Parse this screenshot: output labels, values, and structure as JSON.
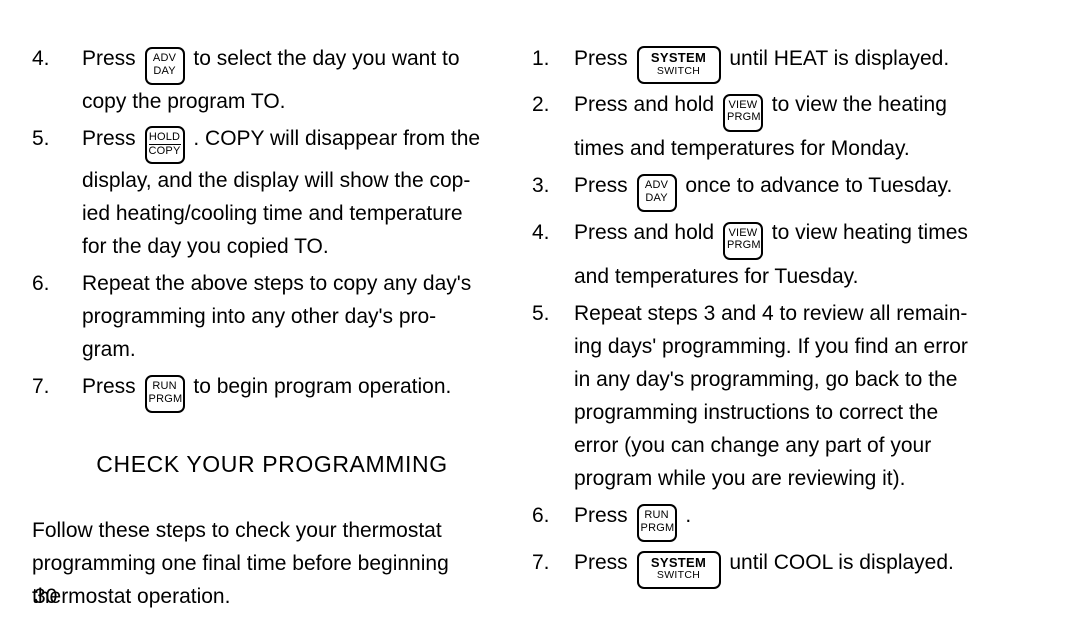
{
  "page": {
    "number": "30",
    "background": "#ffffff",
    "text_color": "#000000"
  },
  "keys": {
    "adv_day": {
      "line1": "ADV",
      "line2": "DAY",
      "ruled": false,
      "wide": false
    },
    "hold_copy": {
      "line1": "HOLD",
      "line2": "COPY",
      "ruled": true,
      "wide": false
    },
    "run_prgm": {
      "line1": "RUN",
      "line2": "PRGM",
      "ruled": false,
      "wide": false
    },
    "view_prgm": {
      "line1": "VIEW",
      "line2": "PRGM",
      "ruled": false,
      "wide": false
    },
    "system_switch": {
      "line1": "SYSTEM",
      "line2": "SWITCH",
      "ruled": false,
      "wide": true
    }
  },
  "left_column": {
    "items": [
      {
        "number": "4.",
        "text_before": "Press",
        "key": "adv_day",
        "text_after_line1": "to select the day you want to",
        "text_after_line2": "copy the program TO."
      },
      {
        "number": "5.",
        "text_before": "Press",
        "key": "hold_copy",
        "text_after_line1": ". COPY will disappear from the",
        "text_after_line2": "display, and the display will show the cop-",
        "text_after_line3": "ied heating/cooling time and temperature",
        "text_after_line4": "for the day you copied TO."
      },
      {
        "number": "6.",
        "line1": "Repeat the above steps to copy any day's",
        "line2": "programming into any other day's pro-",
        "line3": "gram."
      },
      {
        "number": "7.",
        "text_before": "Press",
        "key": "run_prgm",
        "text_after_line1": "to begin program operation."
      }
    ],
    "heading": "CHECK YOUR PROGRAMMING",
    "paragraph": {
      "line1": "Follow these steps to check your thermostat",
      "line2": "programming one final time before beginning",
      "line3": "thermostat operation."
    }
  },
  "right_column": {
    "items": [
      {
        "number": "1.",
        "text_before": "Press",
        "key": "system_switch",
        "text_after_line1": "until HEAT is displayed."
      },
      {
        "number": "2.",
        "text_before": "Press and hold",
        "key": "view_prgm",
        "text_after_line1": "to view the heating",
        "text_after_line2": "times and temperatures for Monday."
      },
      {
        "number": "3.",
        "text_before": "Press",
        "key": "adv_day",
        "text_after_line1": "once to advance to Tuesday."
      },
      {
        "number": "4.",
        "text_before": "Press and hold",
        "key": "view_prgm",
        "text_after_line1": "to view heating times",
        "text_after_line2": "and temperatures for Tuesday."
      },
      {
        "number": "5.",
        "line1": "Repeat steps 3 and 4 to review all remain-",
        "line2": "ing days' programming. If you find an error",
        "line3": "in any day's programming, go back to the",
        "line4": "programming instructions to correct the",
        "line5": "error (you can change any part of your",
        "line6": "program while you are reviewing it)."
      },
      {
        "number": "6.",
        "text_before": "Press",
        "key": "run_prgm",
        "text_after_line1": "."
      },
      {
        "number": "7.",
        "text_before": "Press",
        "key": "system_switch",
        "text_after_line1": "until COOL is displayed."
      }
    ]
  }
}
